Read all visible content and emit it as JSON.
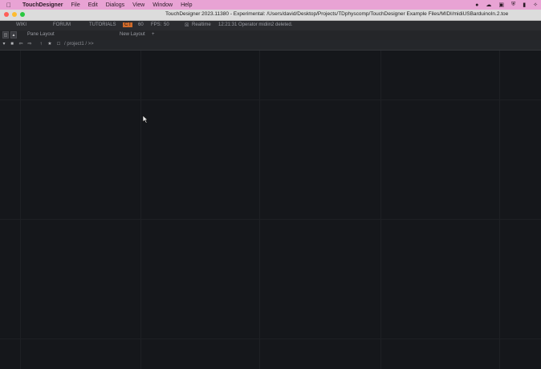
{
  "menubar": {
    "apple_icon": "apple-icon",
    "app_name": "TouchDesigner",
    "items": [
      "File",
      "Edit",
      "Dialogs",
      "View",
      "Window",
      "Help"
    ]
  },
  "window": {
    "title": "TouchDesigner 2023.11380 - Experimental: /Users/david/Desktop/Projects/TDphyscomp/TouchDesigner Example Files/MIDI/midiUSBarduinoIn.2.toe"
  },
  "toolbar": {
    "wiki": "WIKI",
    "forum": "FORUM",
    "tutorials": "TUTORIALS",
    "perf_label": "C I",
    "perf_value": "60",
    "fps_label": "FPS:",
    "fps_value": "50",
    "realtime_label": "Realtime",
    "status": "12:21:31 Operator midiin2 deleted."
  },
  "panebar": {
    "pane_layout": "Pane Layout",
    "new_layout": "New Layout",
    "add": "+"
  },
  "navbar": {
    "path": "/ project1 / >>"
  },
  "colors": {
    "menubar_bg": "#e8a3d4",
    "network_bg": "#15171b",
    "perf_accent": "#d06a2a",
    "close": "#ff5f57",
    "minimize": "#febc2e",
    "zoom": "#28c840"
  }
}
